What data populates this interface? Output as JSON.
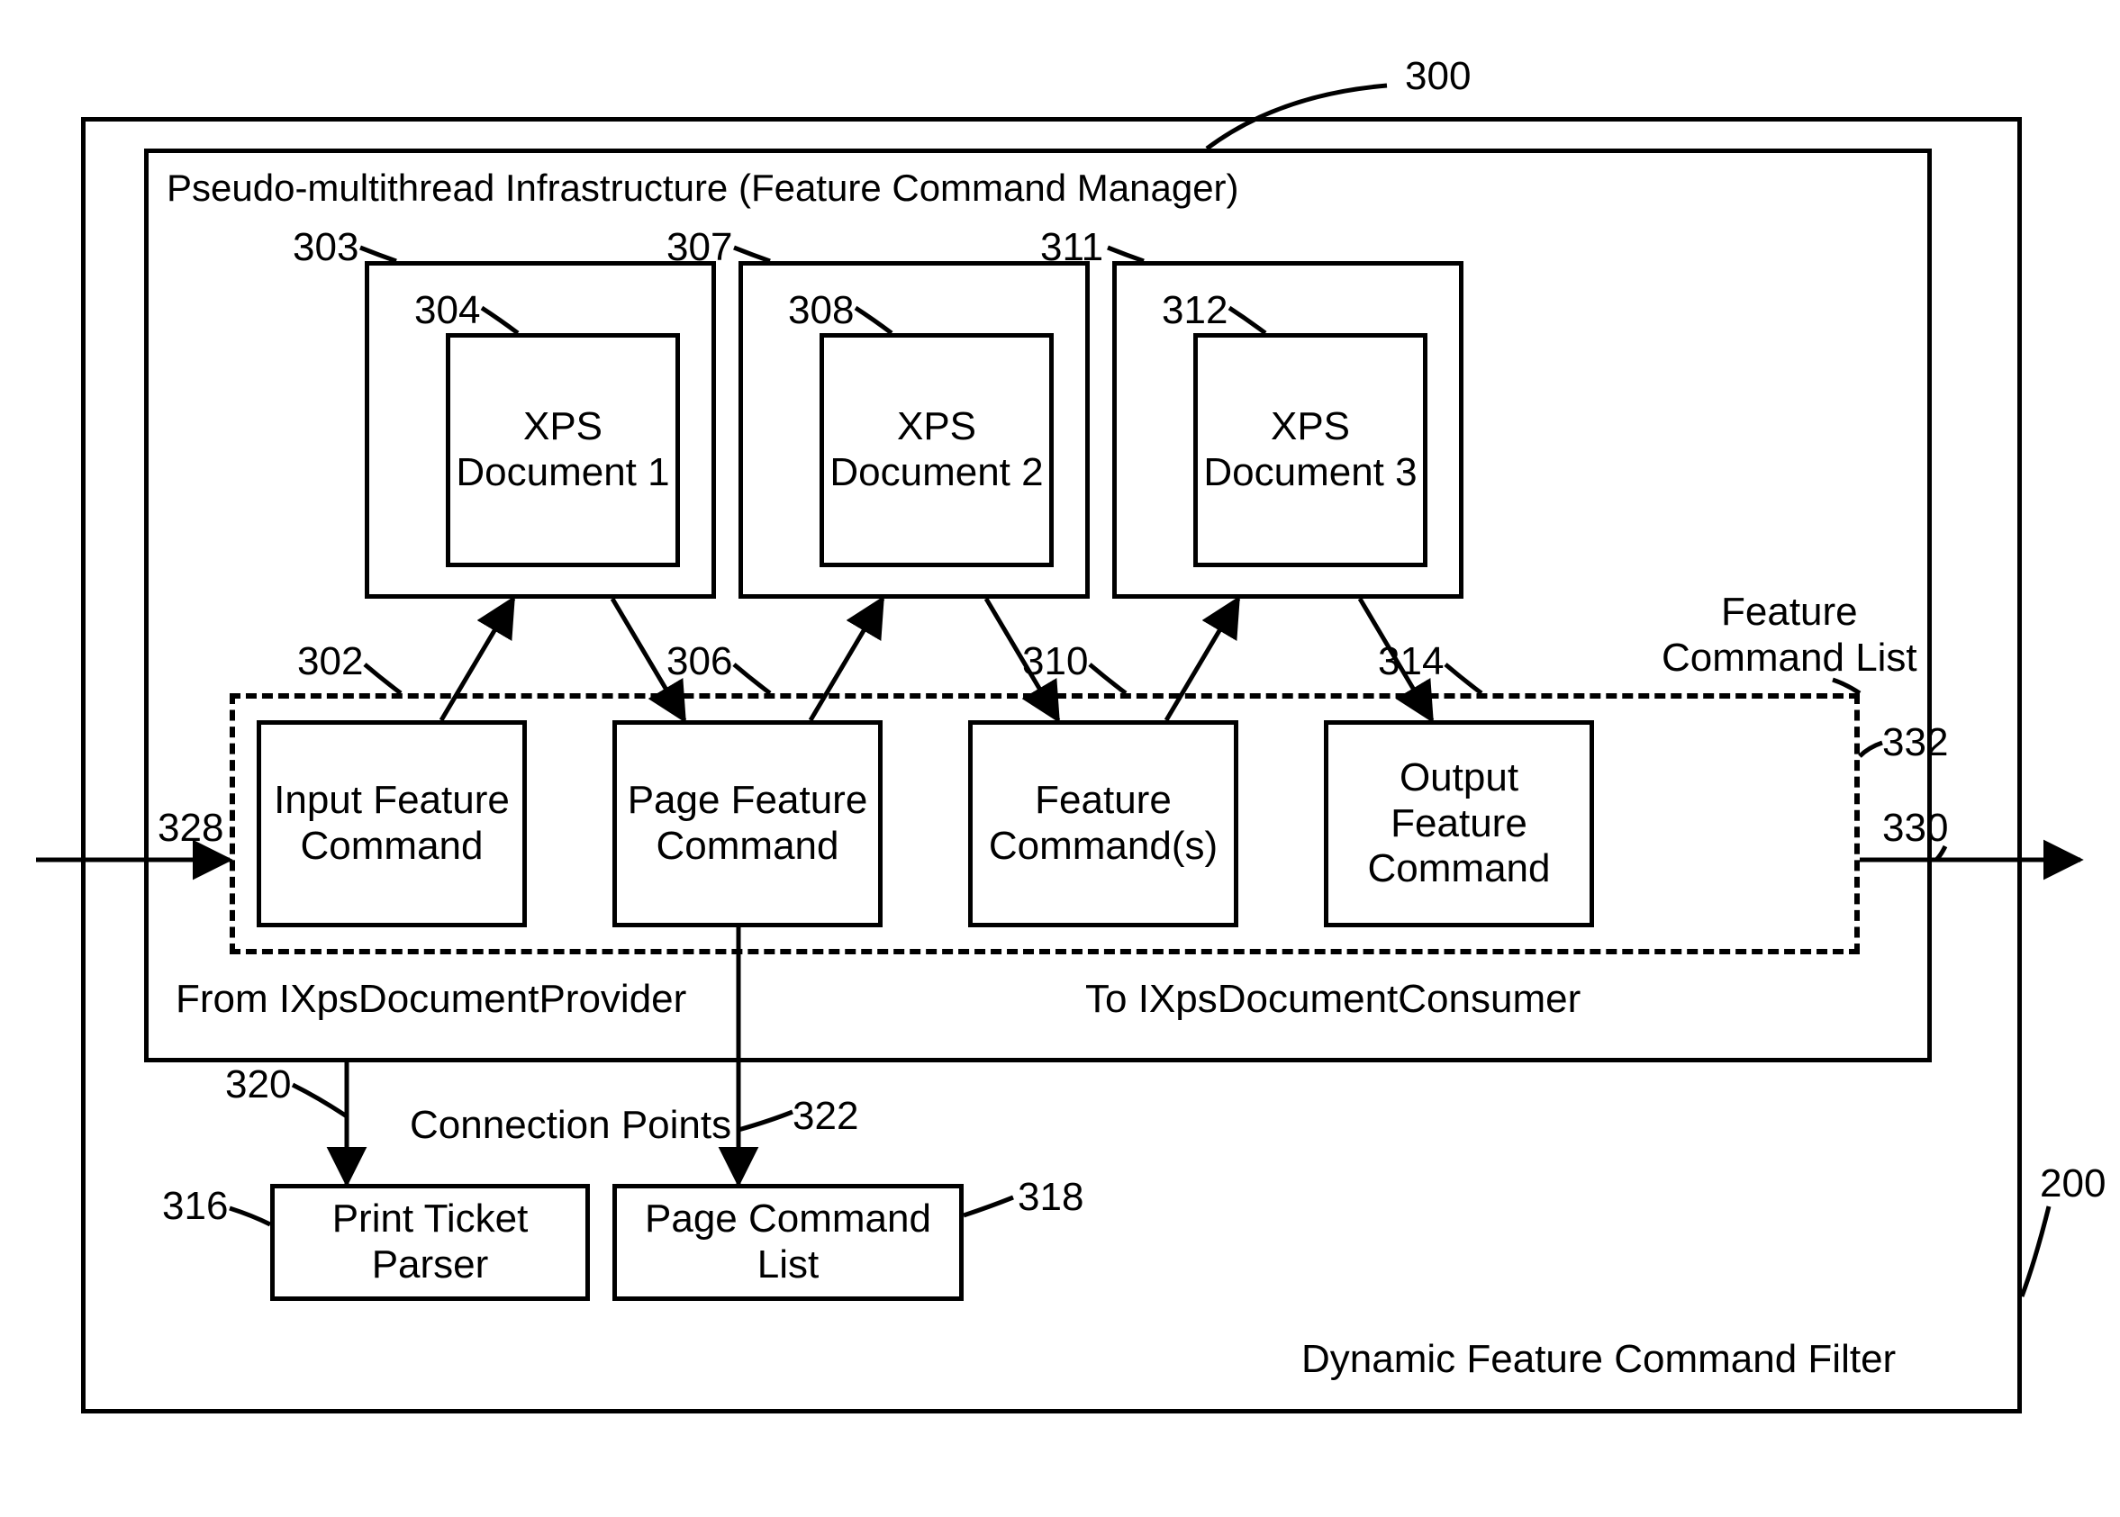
{
  "outer": {
    "ref": "200",
    "title": "Dynamic Feature Command Filter"
  },
  "manager": {
    "ref": "300",
    "title": "Pseudo-multithread Infrastructure (Feature Command Manager)"
  },
  "docs": {
    "d1": {
      "outerRef": "303",
      "innerRef": "304",
      "label": "XPS\nDocument 1"
    },
    "d2": {
      "outerRef": "307",
      "innerRef": "308",
      "label": "XPS\nDocument 2"
    },
    "d3": {
      "outerRef": "311",
      "innerRef": "312",
      "label": "XPS\nDocument 3"
    }
  },
  "featureList": {
    "label": "Feature\nCommand List",
    "ref": "332",
    "commands": {
      "input": {
        "ref": "302",
        "label": "Input Feature\nCommand"
      },
      "page": {
        "ref": "306",
        "label": "Page\nFeature\nCommand"
      },
      "feat": {
        "ref": "310",
        "label": "Feature\nCommand(s)"
      },
      "output": {
        "ref": "314",
        "label": "Output\nFeature\nCommand"
      }
    }
  },
  "io": {
    "fromProvider": {
      "ref": "328",
      "label": "From IXpsDocumentProvider"
    },
    "toConsumer": {
      "ref": "330",
      "label": "To IXpsDocumentConsumer"
    }
  },
  "connections": {
    "label": "Connection Points",
    "ptp": {
      "arrowRef": "320",
      "boxRef": "316",
      "boxLabel": "Print Ticket Parser"
    },
    "pcl": {
      "arrowRef": "322",
      "boxRef": "318",
      "boxLabel": "Page Command List"
    }
  }
}
